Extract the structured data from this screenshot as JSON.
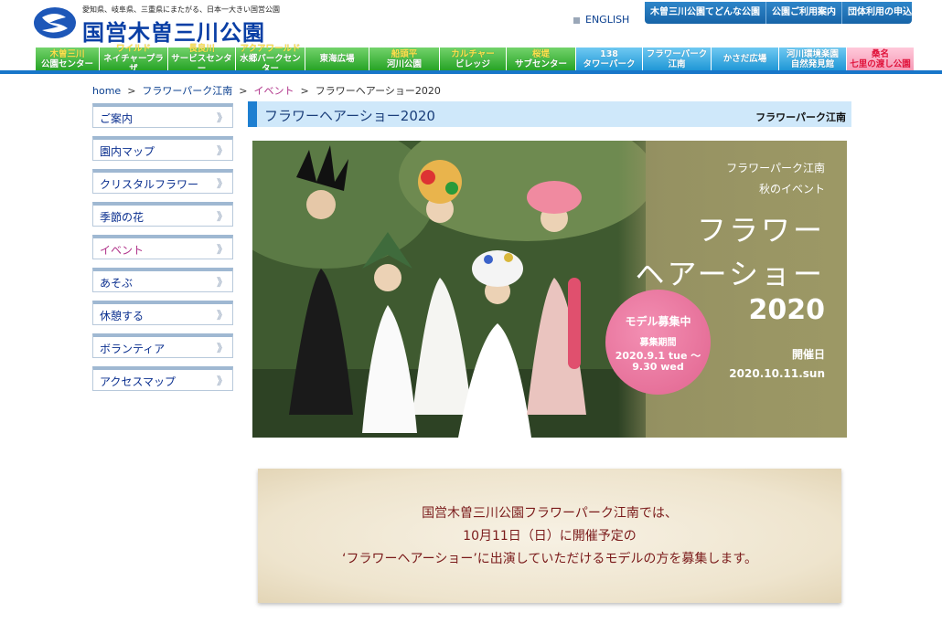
{
  "header": {
    "tagline": "愛知県、岐阜県、三重県にまたがる、日本一大きい国営公園",
    "site_title": "国営木曽三川公園",
    "english_label": "ENGLISH",
    "top_links": [
      "木曽三川公園てどんな公園",
      "公園ご利用案内",
      "団体利用の申込"
    ]
  },
  "nav": {
    "items": [
      {
        "l1": "木曽三川",
        "l2": "公園センター"
      },
      {
        "l1": "ワイルド",
        "l2": "ネイチャープラザ"
      },
      {
        "l1": "長良川",
        "l2": "サービスセンター"
      },
      {
        "l1": "アクアワールド",
        "l2": "水郷パークセンター"
      },
      {
        "l1": "東海広場",
        "l2": ""
      },
      {
        "l1": "船頭平",
        "l2": "河川公園"
      },
      {
        "l1": "カルチャー",
        "l2": "ビレッジ"
      },
      {
        "l1": "桜堤",
        "l2": "サブセンター"
      },
      {
        "l1": "138",
        "l2": "タワーパーク"
      },
      {
        "l1": "フラワーパーク",
        "l2": "江南"
      },
      {
        "l1": "かさだ広場",
        "l2": ""
      },
      {
        "l1": "河川環境楽園",
        "l2": "自然発見館"
      },
      {
        "l1": "桑名",
        "l2": "七里の渡し公園"
      }
    ]
  },
  "breadcrumb": {
    "home": "home",
    "sep": ">",
    "park": "フラワーパーク江南",
    "section": "イベント",
    "current": "フラワーヘアーショー2020"
  },
  "sidebar": {
    "arrow": "》",
    "items": [
      {
        "label": "ご案内"
      },
      {
        "label": "園内マップ"
      },
      {
        "label": "クリスタルフラワー"
      },
      {
        "label": "季節の花"
      },
      {
        "label": "イベント"
      },
      {
        "label": "あそぶ"
      },
      {
        "label": "休憩する"
      },
      {
        "label": "ボランティア"
      },
      {
        "label": "アクセスマップ"
      }
    ]
  },
  "page": {
    "title": "フラワーヘアーショー2020",
    "park_label": "フラワーパーク江南"
  },
  "hero": {
    "sub1": "フラワーパーク江南",
    "sub2": "秋のイベント",
    "big1": "フラワー",
    "big2": "ヘアーショー",
    "year": "2020",
    "badge_title": "モデル募集中",
    "badge_period_label": "募集期間",
    "badge_start": "2020.9.1 tue ～",
    "badge_end": "9.30 wed",
    "held_label": "開催日",
    "held_date": "2020.10.11.sun"
  },
  "message": {
    "line1": "国営木曽三川公園フラワーパーク江南では、",
    "line2": "10月11日（日）に開催予定の",
    "line3": "‘フラワーヘアーショー’に出演していただけるモデルの方を募集します。"
  },
  "colors": {
    "accent_blue": "#1e7fd1",
    "nav_green": "#26a326",
    "nav_blue": "#1f97d6",
    "nav_pink": "#f59ab6",
    "badge_pink": "#e1648f",
    "message_text": "#7a1a1a"
  }
}
